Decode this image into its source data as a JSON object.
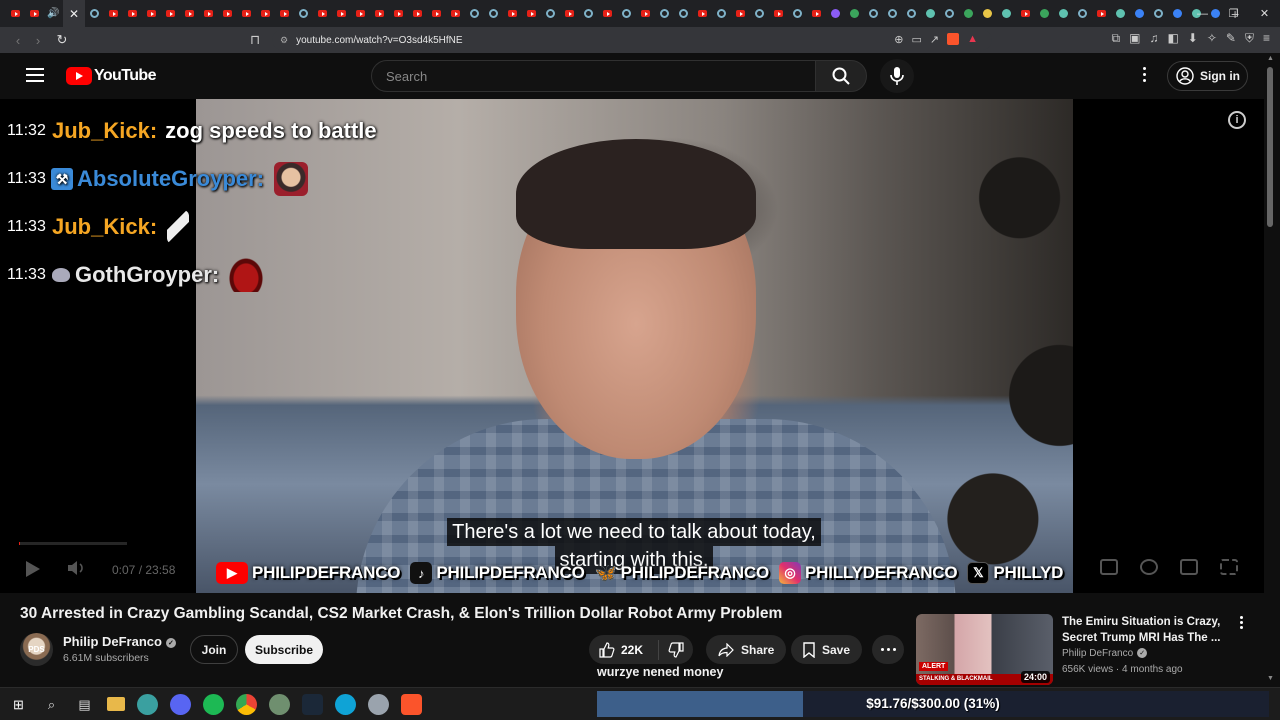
{
  "browser": {
    "url": "youtube.com/watch?v=O3sd4k5HfNE",
    "tab_favicons": [
      "yt",
      "yt",
      "yt",
      "yt",
      "ring",
      "yt",
      "yt",
      "yt",
      "yt",
      "yt",
      "yt",
      "yt",
      "yt",
      "yt",
      "yt",
      "ring",
      "yt",
      "yt",
      "yt",
      "yt",
      "yt",
      "yt",
      "yt",
      "yt",
      "ring",
      "ring",
      "yt",
      "yt",
      "ring",
      "yt",
      "ring",
      "yt",
      "ring",
      "yt",
      "ring",
      "ring",
      "yt",
      "ring",
      "yt",
      "ring",
      "yt",
      "ring",
      "yt",
      "purple",
      "green",
      "ring",
      "ring",
      "ring",
      "teal",
      "ring",
      "green",
      "yellow",
      "teal",
      "yt",
      "green",
      "teal",
      "ring",
      "yt",
      "teal",
      "blue",
      "ring",
      "blue",
      "teal",
      "blue"
    ]
  },
  "masthead": {
    "logo_text": "YouTube",
    "search_placeholder": "Search",
    "sign_in_label": "Sign in"
  },
  "chat": [
    {
      "time": "11:32",
      "user": "Jub_Kick:",
      "user_color": "#f5a623",
      "message": "zog speeds to battle",
      "badge": "",
      "emote": ""
    },
    {
      "time": "11:33",
      "user": "AbsoluteGroyper:",
      "user_color": "#3a8ad8",
      "message": "",
      "badge": "hammer-badge",
      "emote": "face-emote"
    },
    {
      "time": "11:33",
      "user": "Jub_Kick:",
      "user_color": "#f5a623",
      "message": "",
      "badge": "",
      "emote": "feather-emote"
    },
    {
      "time": "11:33",
      "user": "GothGroyper:",
      "user_color": "#e8e8e8",
      "message": "",
      "badge": "goth-badge",
      "emote": "hat-emote"
    }
  ],
  "captions": {
    "line1": "There's a lot we need to talk about today,",
    "line2": "starting with this."
  },
  "socials": [
    {
      "icon": "youtube-icon",
      "handle": "PHILIPDEFRANCO"
    },
    {
      "icon": "tiktok-icon",
      "handle": "PHILIPDEFRANCO"
    },
    {
      "icon": "bluesky-icon",
      "handle": "PHILIPDEFRANCO"
    },
    {
      "icon": "instagram-icon",
      "handle": "PHILLYDEFRANCO"
    },
    {
      "icon": "x-icon",
      "handle": "PHILLYD"
    }
  ],
  "player": {
    "time": "0:07 / 23:58",
    "progress_fraction": 0.005
  },
  "video": {
    "title": "30 Arrested in Crazy Gambling Scandal, CS2 Market Crash, & Elon's Trillion Dollar Robot Army Problem",
    "channel": "Philip DeFranco",
    "avatar_text": "PDS",
    "subscribers": "6.61M subscribers",
    "join_label": "Join",
    "subscribe_label": "Subscribe",
    "likes": "22K",
    "share_label": "Share",
    "save_label": "Save"
  },
  "overlay_text": "wurzye nened money",
  "recommended": {
    "title": "The Emiru Situation is Crazy, Secret Trump MRI Has The ...",
    "channel": "Philip DeFranco",
    "meta": "656K views · 4 months ago",
    "duration": "24:00",
    "alert_label": "ALERT",
    "strip_label": "STALKING & BLACKMAIL"
  },
  "donation_goal": {
    "text": "$91.76/$300.00 (31%)",
    "fraction": 0.3059
  },
  "colors": {
    "youtube_red": "#ff0000",
    "goal_fill": "#3d5f8a"
  }
}
